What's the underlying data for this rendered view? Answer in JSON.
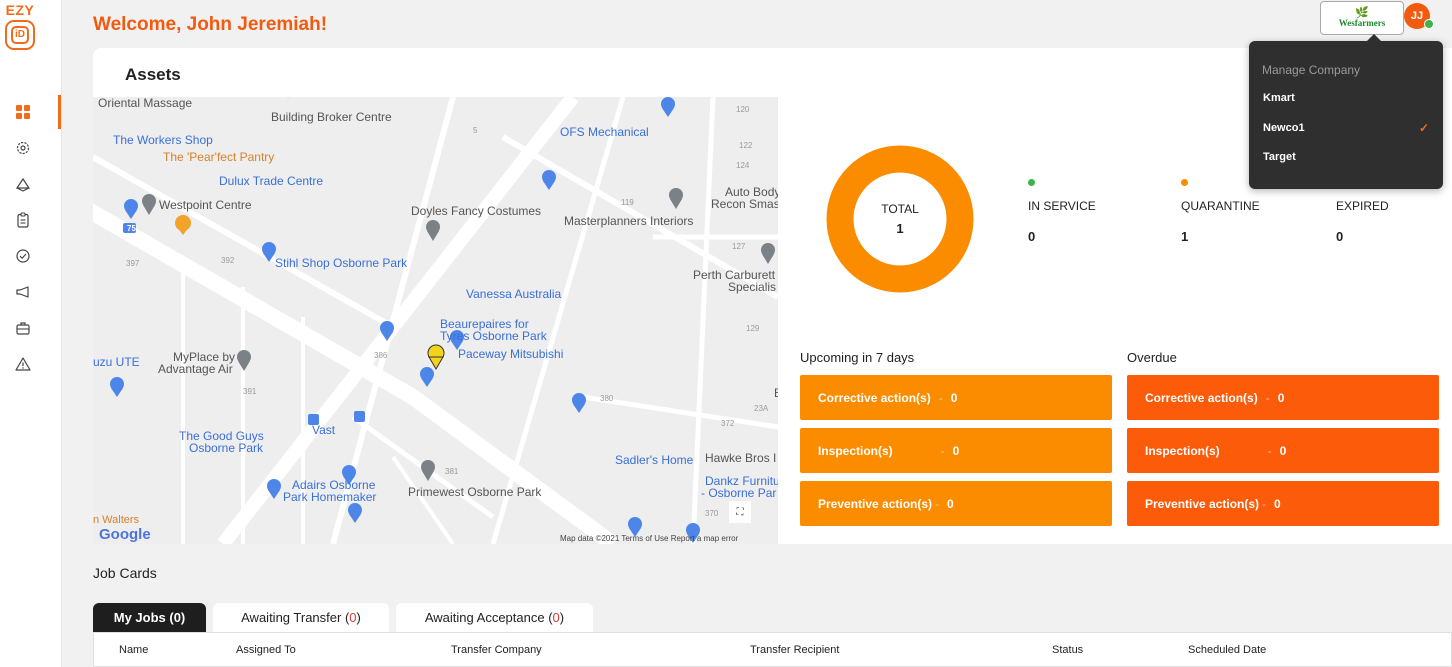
{
  "logo": {
    "top_text": "EZY",
    "badge_text": "iD"
  },
  "sidebar": {
    "items": [
      {
        "name": "dashboard",
        "icon": "dashboard-grid-icon",
        "active": true
      },
      {
        "name": "settings",
        "icon": "gear-icon"
      },
      {
        "name": "assets",
        "icon": "cube-stack-icon"
      },
      {
        "name": "clipboard",
        "icon": "clipboard-icon"
      },
      {
        "name": "tasks",
        "icon": "check-circle-icon"
      },
      {
        "name": "announcements",
        "icon": "megaphone-icon"
      },
      {
        "name": "jobs",
        "icon": "briefcase-icon"
      },
      {
        "name": "alerts",
        "icon": "warning-triangle-icon"
      }
    ]
  },
  "header": {
    "welcome": "Welcome, John Jeremiah!",
    "company_logo_text": "Wesfarmers",
    "avatar_initials": "JJ"
  },
  "company_menu": {
    "header": "Manage Company",
    "items": [
      {
        "label": "Kmart",
        "selected": false
      },
      {
        "label": "Newco1",
        "selected": true
      },
      {
        "label": "Target",
        "selected": false
      }
    ]
  },
  "assets": {
    "title": "Assets",
    "map": {
      "labels": {
        "oriental": "Oriental Massage",
        "building_broker": "Building Broker Centre",
        "workers_shop": "The Workers Shop",
        "pearfect": "The 'Pear'fect Pantry",
        "dulux": "Dulux Trade Centre",
        "westpoint": "Westpoint Centre",
        "doyles": "Doyles Fancy Costumes",
        "masterplanners": "Masterplanners Interiors",
        "auto_body": "Auto Body",
        "recon": "Recon Smas",
        "ofs": "OFS Mechanical",
        "stihl": "Stihl Shop Osborne Park",
        "vanessa": "Vanessa Australia",
        "perth_carb": "Perth Carburett",
        "specialis": "Specialis",
        "beaurepaires1": "Beaurepaires for",
        "beaurepaires2": "Tyres Osborne Park",
        "paceway": "Paceway Mitsubishi",
        "myplace1": "MyPlace by",
        "myplace2": "Advantage Air",
        "uzu": "uzu UTE",
        "good_guys1": "The Good Guys",
        "good_guys2": "Osborne Park",
        "vast": "Vast",
        "adairs1": "Adairs Osborne",
        "adairs2": "Park Homemaker",
        "primewest": "Primewest Osborne Park",
        "sadlers": "Sadler's Home",
        "hawke": "Hawke Bros I",
        "dankz1": "Dankz Furnitu",
        "dankz2": "- Osborne Par",
        "walters": "n Walters",
        "google": "Google",
        "footer": "Map data ©2021   Terms of Use   Report a map error"
      },
      "numbers": [
        "120",
        "122",
        "124",
        "5",
        "119",
        "127",
        "397",
        "392",
        "129",
        "386",
        "391",
        "380",
        "23A",
        "372",
        "381",
        "370",
        "75",
        "E"
      ]
    },
    "total_label": "TOTAL",
    "total_value": "1",
    "stats": [
      {
        "label": "IN SERVICE",
        "value": "0",
        "color": "#3db34a"
      },
      {
        "label": "QUARANTINE",
        "value": "1",
        "color": "#fb8c00"
      },
      {
        "label": "EXPIRED",
        "value": "0",
        "color": "#fc5b0a"
      }
    ],
    "upcoming_title": "Upcoming in 7 days",
    "overdue_title": "Overdue",
    "upcoming": [
      {
        "label": "Corrective action(s)",
        "sep": "-",
        "value": "0"
      },
      {
        "label": "Inspection(s)",
        "sep": "-",
        "value": "0"
      },
      {
        "label": "Preventive action(s)",
        "sep": "-",
        "value": "0"
      }
    ],
    "overdue": [
      {
        "label": "Corrective action(s)",
        "sep": "-",
        "value": "0"
      },
      {
        "label": "Inspection(s)",
        "sep": "-",
        "value": "0"
      },
      {
        "label": "Preventive action(s)",
        "sep": "-",
        "value": "0"
      }
    ]
  },
  "job_cards": {
    "title": "Job Cards",
    "tabs": [
      {
        "label": "My Jobs",
        "count": "(0)"
      },
      {
        "label": "Awaiting Transfer",
        "count": "0"
      },
      {
        "label": "Awaiting Acceptance",
        "count": "0"
      }
    ],
    "columns": [
      "Name",
      "Assigned To",
      "Transfer Company",
      "Transfer Recipient",
      "Status",
      "Scheduled Date"
    ]
  },
  "colors": {
    "brand": "#f26a1b",
    "upcoming": "#fb8c00",
    "overdue": "#fc5b0a",
    "online": "#3db34a"
  }
}
